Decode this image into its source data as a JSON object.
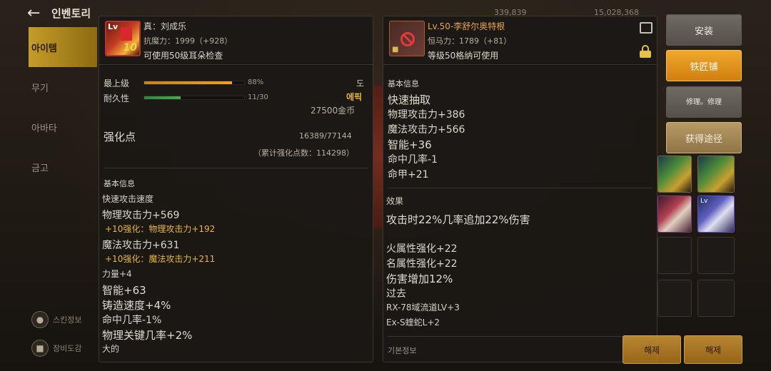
{
  "topbar": {
    "back_icon": "arrow-left-icon",
    "title": "인벤토리",
    "currency_1": "339,839",
    "currency_2": "15,028,368"
  },
  "leftnav": {
    "items": [
      {
        "label": "아이템",
        "active": true
      },
      {
        "label": "무기",
        "active": false
      },
      {
        "label": "아바타",
        "active": false
      },
      {
        "label": "금고",
        "active": false
      }
    ],
    "bottom": [
      {
        "label": "스킨정보",
        "icon": "avatar-icon"
      },
      {
        "label": "장비도감",
        "icon": "book-icon"
      }
    ]
  },
  "left_panel": {
    "icon_level": "Lv",
    "icon_plus": "10",
    "name": "真：刘成乐",
    "sub": "抗魔力：1999（+928）",
    "desc": "可使用50级耳朵检查",
    "rows": {
      "max_level_label": "最上级",
      "max_level_pct": "88%",
      "max_level_value": 0.88,
      "durability_label": "耐久性",
      "durability_text": "11/30",
      "durability_value": 0.367,
      "grade_char": "도",
      "epic_label": "에픽",
      "price": "27500金币"
    },
    "enhance": {
      "title": "强化点",
      "value": "16389/77144",
      "total": "（累计强化点数：114298）"
    },
    "basic_info": {
      "title": "基本信息",
      "lines": [
        {
          "text": "快速攻击速度",
          "style": "normal"
        },
        {
          "text": "物理攻击力+569",
          "style": "mid"
        },
        {
          "text": "+10强化：物理攻击力+192",
          "style": "gold"
        },
        {
          "text": "魔法攻击力+631",
          "style": "mid"
        },
        {
          "text": "+10强化：魔法攻击力+211",
          "style": "gold"
        },
        {
          "text": "力量+4",
          "style": "normal"
        },
        {
          "text": "智能+63",
          "style": "big"
        },
        {
          "text": "铸造速度+4%",
          "style": "big"
        },
        {
          "text": "命中几率-1%",
          "style": "mid"
        },
        {
          "text": "物理关键几率+2%",
          "style": "big"
        },
        {
          "text": "大的",
          "style": "normal"
        }
      ]
    }
  },
  "right_panel": {
    "name_prefix": "Lv.50-",
    "name": "李舒尔奥特根",
    "sub": "恒马力：1789（+81）",
    "desc": "等级50格纳可使用",
    "basic_info": {
      "title": "基本信息",
      "lines": [
        {
          "text": "快速抽取",
          "style": "big"
        },
        {
          "text": "物理攻击力+386",
          "style": "mid"
        },
        {
          "text": "魔法攻击力+566",
          "style": "mid"
        },
        {
          "text": "智能+36",
          "style": "big"
        },
        {
          "text": "命中几率-1",
          "style": "mid"
        },
        {
          "text": "命甲+21",
          "style": "mid"
        }
      ]
    },
    "effect": {
      "title": "效果",
      "lines": [
        {
          "text": "攻击时22%几率追加22%伤害",
          "style": "big"
        },
        {
          "text": "火属性强化+22",
          "style": "mid"
        },
        {
          "text": "名属性强化+22",
          "style": "mid"
        },
        {
          "text": "伤害增加12%",
          "style": "big"
        },
        {
          "text": "过去",
          "style": "mid"
        },
        {
          "text": "RX-78域流道LV+3",
          "style": "normal"
        },
        {
          "text": "Ex-S蝰蛇L+2",
          "style": "normal"
        }
      ]
    },
    "footer_partial": "기본정보"
  },
  "side_buttons": {
    "install": "安装",
    "smith": "铁匠铺",
    "repair": "修理。修理",
    "obtain": "获得途径"
  },
  "bottom_buttons": {
    "left": "해제",
    "right": "해제"
  },
  "colors": {
    "accent_gold": "#e8b640",
    "orange_button": "#f0a72a",
    "level_orange": "#e8a44b",
    "bar_gold": "#f0a020",
    "bar_green": "#3bb04a"
  }
}
